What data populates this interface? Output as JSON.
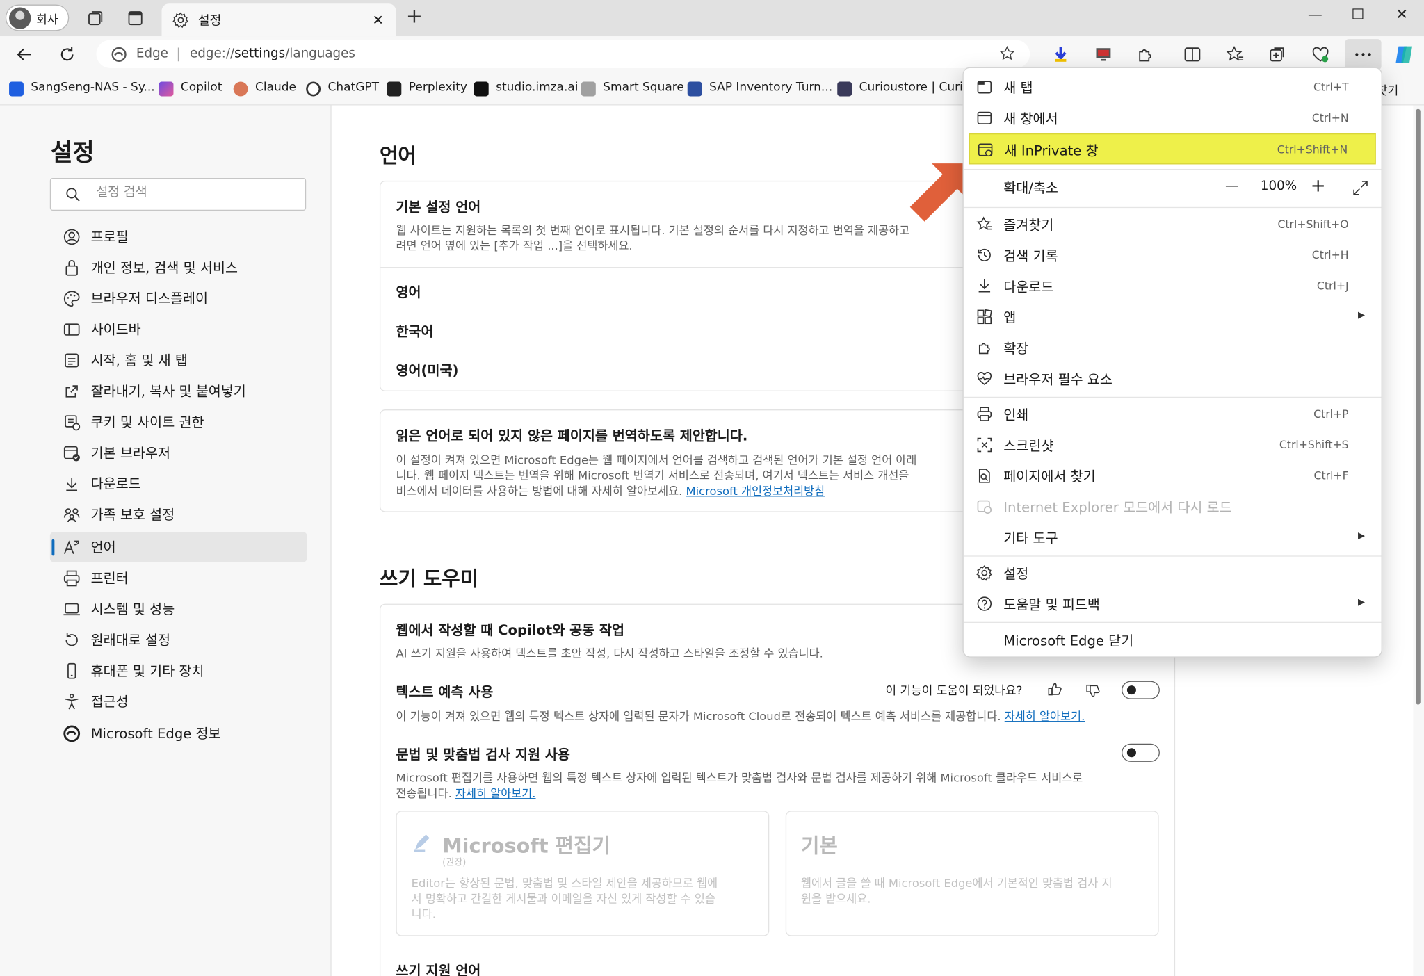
{
  "window": {
    "profile_label": "회사",
    "tab_title": "설정",
    "new_tab_symbol": "+",
    "minimize": "—",
    "maximize": "☐",
    "close": "✕"
  },
  "address_bar": {
    "site_label": "Edge",
    "separator": "|",
    "url_prefix": "edge://",
    "url_main": "settings",
    "url_suffix": "/languages"
  },
  "bookmarks": [
    {
      "label": "SangSeng-NAS - Sy...",
      "color": "#1f5fe0"
    },
    {
      "label": "Copilot",
      "color": "#6f4ce0"
    },
    {
      "label": "Claude",
      "color": "#d97757"
    },
    {
      "label": "ChatGPT",
      "color": "#333333"
    },
    {
      "label": "Perplexity",
      "color": "#222222"
    },
    {
      "label": "studio.imza.ai",
      "color": "#111111"
    },
    {
      "label": "Smart Square",
      "color": "#a0a0a0"
    },
    {
      "label": "SAP Inventory Turn...",
      "color": "#2d4fa0"
    },
    {
      "label": "Curioustore | Curiou",
      "color": "#3a3a5a"
    },
    {
      "label": "즐겨찾기",
      "color": "#f2c94c"
    }
  ],
  "sidebar": {
    "title": "설정",
    "search_placeholder": "설정 검색",
    "items": [
      {
        "label": "프로필",
        "icon": "profile-icon"
      },
      {
        "label": "개인 정보, 검색 및 서비스",
        "icon": "lock-icon"
      },
      {
        "label": "브라우저 디스플레이",
        "icon": "palette-icon"
      },
      {
        "label": "사이드바",
        "icon": "sidebar-icon"
      },
      {
        "label": "시작, 홈 및 새 탭",
        "icon": "home-tab-icon"
      },
      {
        "label": "잘라내기, 복사 및 붙여넣기",
        "icon": "share-icon"
      },
      {
        "label": "쿠키 및 사이트 권한",
        "icon": "cookie-icon"
      },
      {
        "label": "기본 브라우저",
        "icon": "default-browser-icon"
      },
      {
        "label": "다운로드",
        "icon": "download-icon"
      },
      {
        "label": "가족 보호 설정",
        "icon": "family-icon"
      },
      {
        "label": "언어",
        "icon": "language-icon",
        "active": true
      },
      {
        "label": "프린터",
        "icon": "printer-icon"
      },
      {
        "label": "시스템 및 성능",
        "icon": "system-icon"
      },
      {
        "label": "원래대로 설정",
        "icon": "reset-icon"
      },
      {
        "label": "휴대폰 및 기타 장치",
        "icon": "phone-icon"
      },
      {
        "label": "접근성",
        "icon": "accessibility-icon"
      },
      {
        "label": "Microsoft Edge 정보",
        "icon": "edge-logo-icon"
      }
    ]
  },
  "main": {
    "languages_heading": "언어",
    "preferred": {
      "title": "기본 설정 언어",
      "desc_line1": "웹 사이트는 지원하는 목록의 첫 번째 언어로 표시됩니다. 기본 설정의 순서를 다시 지정하고 번역을 제공하고",
      "desc_line2": "려면 언어 옆에 있는 [추가 작업 ...]을 선택하세요.",
      "languages": [
        "영어",
        "한국어",
        "영어(미국)"
      ]
    },
    "translate": {
      "title": "읽은 언어로 되어 있지 않은 페이지를 번역하도록 제안합니다.",
      "desc_line1": "이 설정이 켜져 있으면 Microsoft Edge는 웹 페이지에서 언어를 검색하고 검색된 언어가 기본 설정 언어 아래",
      "desc_line2": "니다. 웹 페이지 텍스트는 번역을 위해 Microsoft 번역기 서비스로 전송되며, 여기서 텍스트는 서비스 개선을",
      "desc_line3": "비스에서 데이터를 사용하는 방법에 대해 자세히 알아보세요.",
      "link": "Microsoft 개인정보처리방침"
    },
    "writing_heading": "쓰기 도우미",
    "copilot": {
      "title": "웹에서 작성할 때 Copilot와 공동 작업",
      "desc": "AI 쓰기 지원을 사용하여 텍스트를 초안 작성, 다시 작성하고 스타일을 조정할 수 있습니다."
    },
    "prediction": {
      "title": "텍스트 예측 사용",
      "feedback_question": "이 기능이 도움이 되었나요?",
      "desc": "이 기능이 켜져 있으면 웹의 특정 텍스트 상자에 입력된 문자가 Microsoft Cloud로 전송되어 텍스트 예측 서비스를 제공합니다.",
      "link": "자세히 알아보기."
    },
    "grammar": {
      "title": "문법 및 맞춤법 검사 지원 사용",
      "desc_line1": "Microsoft 편집기를 사용하면 웹의 특정 텍스트 상자에 입력된 텍스트가 맞춤법 검사와 문법 검사를 제공하기 위해 Microsoft 클라우드 서비스로",
      "desc_line2": "전송됩니다.",
      "link": "자세히 알아보기."
    },
    "editor_option": {
      "title": "Microsoft 편집기",
      "badge": "(권장)",
      "desc_line1": "Editor는 향상된 문법, 맞춤법 및 스타일 제안을 제공하므로 웹에",
      "desc_line2": "서 명확하고 간결한 게시물과 이메일을 자신 있게 작성할 수 있습",
      "desc_line3": "니다."
    },
    "basic_option": {
      "title": "기본",
      "desc_line1": "웹에서 글을 쓸 때 Microsoft Edge에서 기본적인 맞춤법 검사 지",
      "desc_line2": "원을 받으세요."
    },
    "writing_lang_title": "쓰기 지원 언어"
  },
  "menu": {
    "items": [
      {
        "label": "새 탭",
        "shortcut": "Ctrl+T",
        "icon": "new-tab-icon"
      },
      {
        "label": "새 창에서",
        "shortcut": "Ctrl+N",
        "icon": "new-window-icon"
      },
      {
        "label": "새 InPrivate 창",
        "shortcut": "Ctrl+Shift+N",
        "icon": "inprivate-icon",
        "highlighted": true
      },
      {
        "label": "즐겨찾기",
        "shortcut": "Ctrl+Shift+O",
        "icon": "favorites-icon"
      },
      {
        "label": "검색 기록",
        "shortcut": "Ctrl+H",
        "icon": "history-icon"
      },
      {
        "label": "다운로드",
        "shortcut": "Ctrl+J",
        "icon": "download-icon"
      },
      {
        "label": "앱",
        "shortcut": "",
        "icon": "apps-icon",
        "submenu": true
      },
      {
        "label": "확장",
        "shortcut": "",
        "icon": "extensions-icon"
      },
      {
        "label": "브라우저 필수 요소",
        "shortcut": "",
        "icon": "essentials-icon"
      },
      {
        "label": "인쇄",
        "shortcut": "Ctrl+P",
        "icon": "print-icon"
      },
      {
        "label": "스크린샷",
        "shortcut": "Ctrl+Shift+S",
        "icon": "screenshot-icon"
      },
      {
        "label": "페이지에서 찾기",
        "shortcut": "Ctrl+F",
        "icon": "find-icon"
      },
      {
        "label": "Internet Explorer 모드에서 다시 로드",
        "shortcut": "",
        "icon": "ie-mode-icon",
        "disabled": true
      },
      {
        "label": "기타 도구",
        "shortcut": "",
        "icon": "",
        "submenu": true
      },
      {
        "label": "설정",
        "shortcut": "",
        "icon": "settings-icon"
      },
      {
        "label": "도움말 및 피드백",
        "shortcut": "",
        "icon": "help-icon",
        "submenu": true
      },
      {
        "label": "Microsoft Edge 닫기",
        "shortcut": "",
        "icon": ""
      }
    ],
    "zoom": {
      "label": "확대/축소",
      "value": "100%",
      "minus": "—",
      "plus": "+"
    },
    "submenu_arrow": "▶"
  },
  "colors": {
    "highlight": "#eef04a",
    "annotation_arrow": "#e0603a",
    "accent": "#0f6cbd"
  }
}
